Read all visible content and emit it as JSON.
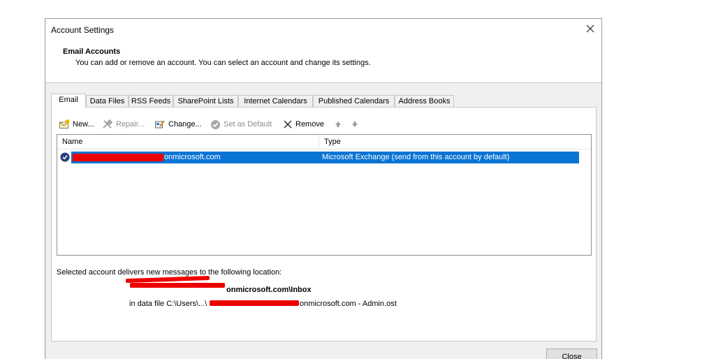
{
  "window": {
    "title": "Account Settings"
  },
  "header": {
    "title": "Email Accounts",
    "description": "You can add or remove an account. You can select an account and change its settings."
  },
  "tabs": [
    {
      "label": "Email",
      "active": true
    },
    {
      "label": "Data Files"
    },
    {
      "label": "RSS Feeds"
    },
    {
      "label": "SharePoint Lists"
    },
    {
      "label": "Internet Calendars"
    },
    {
      "label": "Published Calendars"
    },
    {
      "label": "Address Books"
    }
  ],
  "toolbar": {
    "new_label": "New...",
    "repair_label": "Repair...",
    "change_label": "Change...",
    "set_default_label": "Set as Default",
    "remove_label": "Remove"
  },
  "accounts_table": {
    "columns": [
      "Name",
      "Type"
    ],
    "rows": [
      {
        "name_suffix": "onmicrosoft.com",
        "type": "Microsoft Exchange (send from this account by default)",
        "selected": true
      }
    ]
  },
  "delivery": {
    "label": "Selected account delivers new messages to the following location:",
    "inbox_suffix": "onmicrosoft.com\\Inbox",
    "data_file_prefix": "in data file C:\\Users\\...\\",
    "data_file_suffix": "onmicrosoft.com - Admin.ost"
  },
  "footer": {
    "close_label": "Close"
  },
  "colors": {
    "selection": "#0a74d4",
    "redaction": "#ee0000",
    "dialog_bg": "#f0f0f0"
  }
}
